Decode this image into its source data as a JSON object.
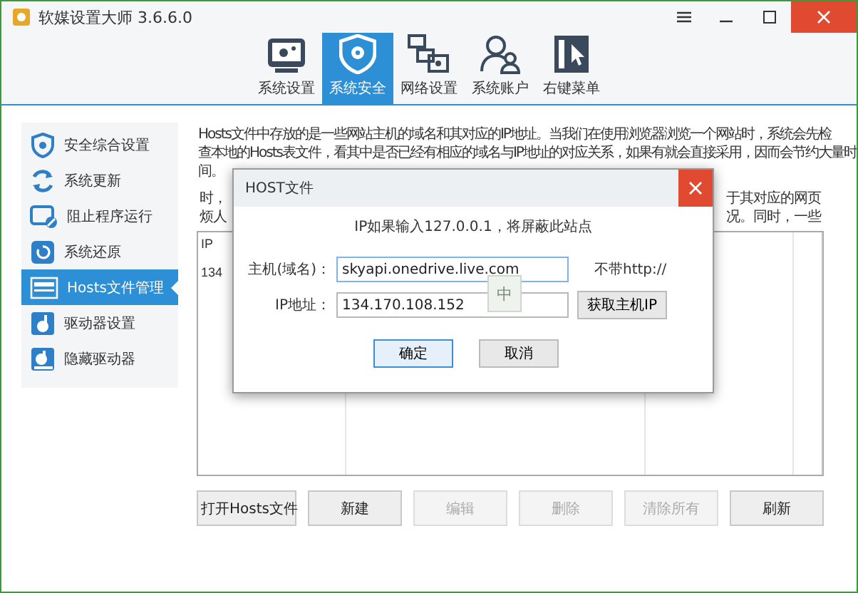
{
  "window": {
    "title": "软媒设置大师 3.6.6.0"
  },
  "toolbar": [
    {
      "label": "系统设置",
      "selected": false
    },
    {
      "label": "系统安全",
      "selected": true
    },
    {
      "label": "网络设置",
      "selected": false
    },
    {
      "label": "系统账户",
      "selected": false
    },
    {
      "label": "右键菜单",
      "selected": false
    }
  ],
  "sidebar": {
    "items": [
      {
        "label": "安全综合设置",
        "selected": false
      },
      {
        "label": "系统更新",
        "selected": false
      },
      {
        "label": "阻止程序运行",
        "selected": false
      },
      {
        "label": "系统还原",
        "selected": false
      },
      {
        "label": "Hosts文件管理",
        "selected": true
      },
      {
        "label": "驱动器设置",
        "selected": false
      },
      {
        "label": "隐藏驱动器",
        "selected": false
      }
    ]
  },
  "intro": [
    "Hosts文件中存放的是一些网站主机的域名和其对应的IP地址。当我们在使用浏览器浏览一个网站时，系统会先检",
    "查本地的Hosts表文件，看其中是否已经有相应的域名与IP地址的对应关系，如果有就会直接采用，因而会节约大量时",
    "间。"
  ],
  "intro_2": {
    "left": [
      "时，",
      "烦人"
    ],
    "right": [
      "于其对应的网页",
      "况。同时，一些"
    ]
  },
  "table": {
    "column_1": "IP",
    "rows": [
      {
        "column_1": "134"
      }
    ]
  },
  "buttons": [
    {
      "label": "打开Hosts文件",
      "disabled": false
    },
    {
      "label": "新建",
      "disabled": false
    },
    {
      "label": "编辑",
      "disabled": true
    },
    {
      "label": "删除",
      "disabled": true
    },
    {
      "label": "清除所有",
      "disabled": true
    },
    {
      "label": "刷新",
      "disabled": false
    }
  ],
  "dialog": {
    "title": "HOST文件",
    "hint": "IP如果输入127.0.0.1，将屏蔽此站点",
    "host_label": "主机(域名)：",
    "host_value": "skyapi.onedrive.live.com",
    "host_note": "不带http://",
    "ip_label": "IP地址：",
    "ip_value": "134.170.108.152",
    "get_ip_button": "获取主机IP",
    "ime_indicator": "中",
    "buttons": [
      {
        "label": "确定",
        "focused": true
      },
      {
        "label": "取消",
        "focused": false
      }
    ]
  }
}
